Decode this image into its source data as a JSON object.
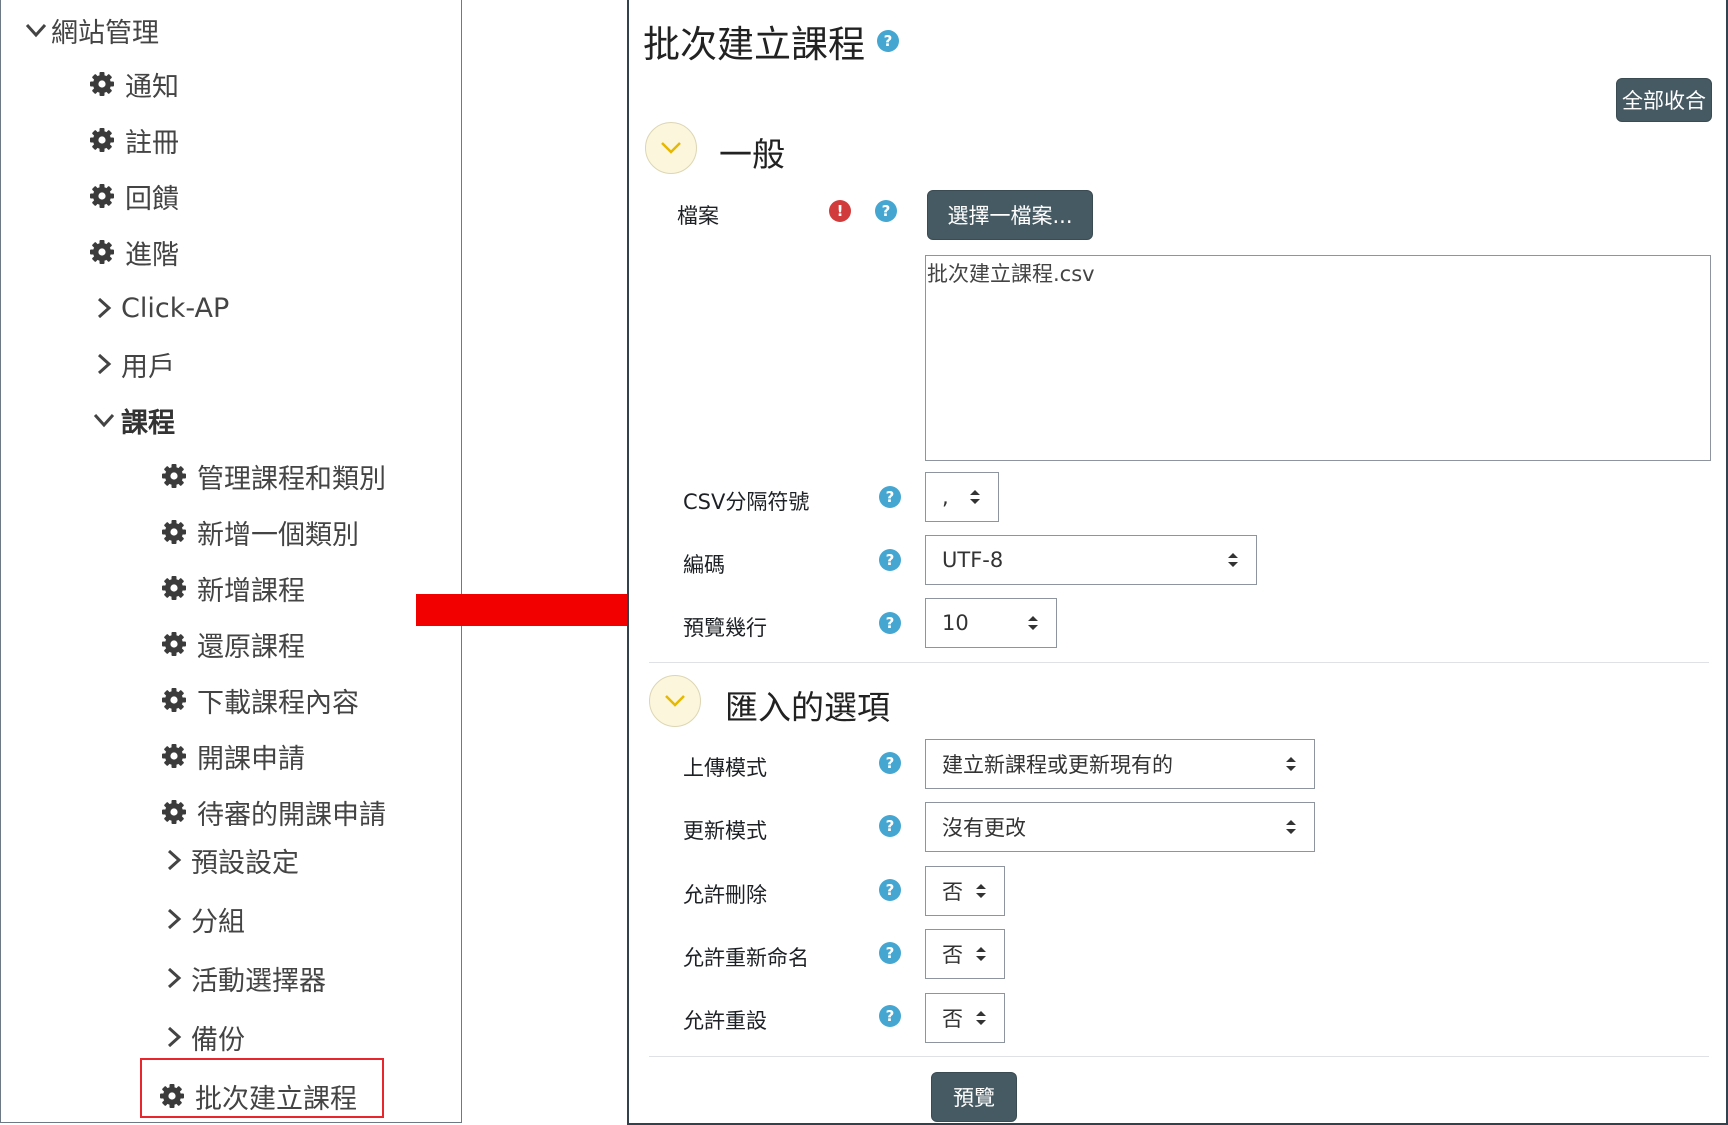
{
  "nav": {
    "site_admin": "網站管理",
    "items": [
      {
        "label": "通知"
      },
      {
        "label": "註冊"
      },
      {
        "label": "回饋"
      },
      {
        "label": "進階"
      },
      {
        "label": "Click-AP"
      },
      {
        "label": "用戶"
      },
      {
        "label": "課程"
      },
      {
        "label": "管理課程和類別"
      },
      {
        "label": "新增一個類別"
      },
      {
        "label": "新增課程"
      },
      {
        "label": "還原課程"
      },
      {
        "label": "下載課程內容"
      },
      {
        "label": "開課申請"
      },
      {
        "label": "待審的開課申請"
      },
      {
        "label": "預設設定"
      },
      {
        "label": "分組"
      },
      {
        "label": "活動選擇器"
      },
      {
        "label": "備份"
      },
      {
        "label": "批次建立課程"
      }
    ]
  },
  "form": {
    "title": "批次建立課程",
    "collapse_all": "全部收合",
    "section_general": "一般",
    "file_label": "檔案",
    "choose_file": "選擇一檔案...",
    "file_name": "批次建立課程.csv",
    "csv_delimiter_label": "CSV分隔符號",
    "csv_delimiter_value": ",",
    "encoding_label": "編碼",
    "encoding_value": "UTF-8",
    "preview_rows_label": "預覽幾行",
    "preview_rows_value": "10",
    "section_import": "匯入的選項",
    "upload_mode_label": "上傳模式",
    "upload_mode_value": "建立新課程或更新現有的",
    "update_mode_label": "更新模式",
    "update_mode_value": "沒有更改",
    "allow_delete_label": "允許刪除",
    "allow_delete_value": "否",
    "allow_rename_label": "允許重新命名",
    "allow_rename_value": "否",
    "allow_reset_label": "允許重設",
    "allow_reset_value": "否",
    "preview_button": "預覽",
    "help_glyph": "?",
    "required_glyph": "!"
  },
  "colors": {
    "accent_button": "#465a63",
    "help_icon": "#45a6d1",
    "required_icon": "#d23b3b",
    "highlight_box": "#e8262d",
    "arrow": "#f20000"
  }
}
